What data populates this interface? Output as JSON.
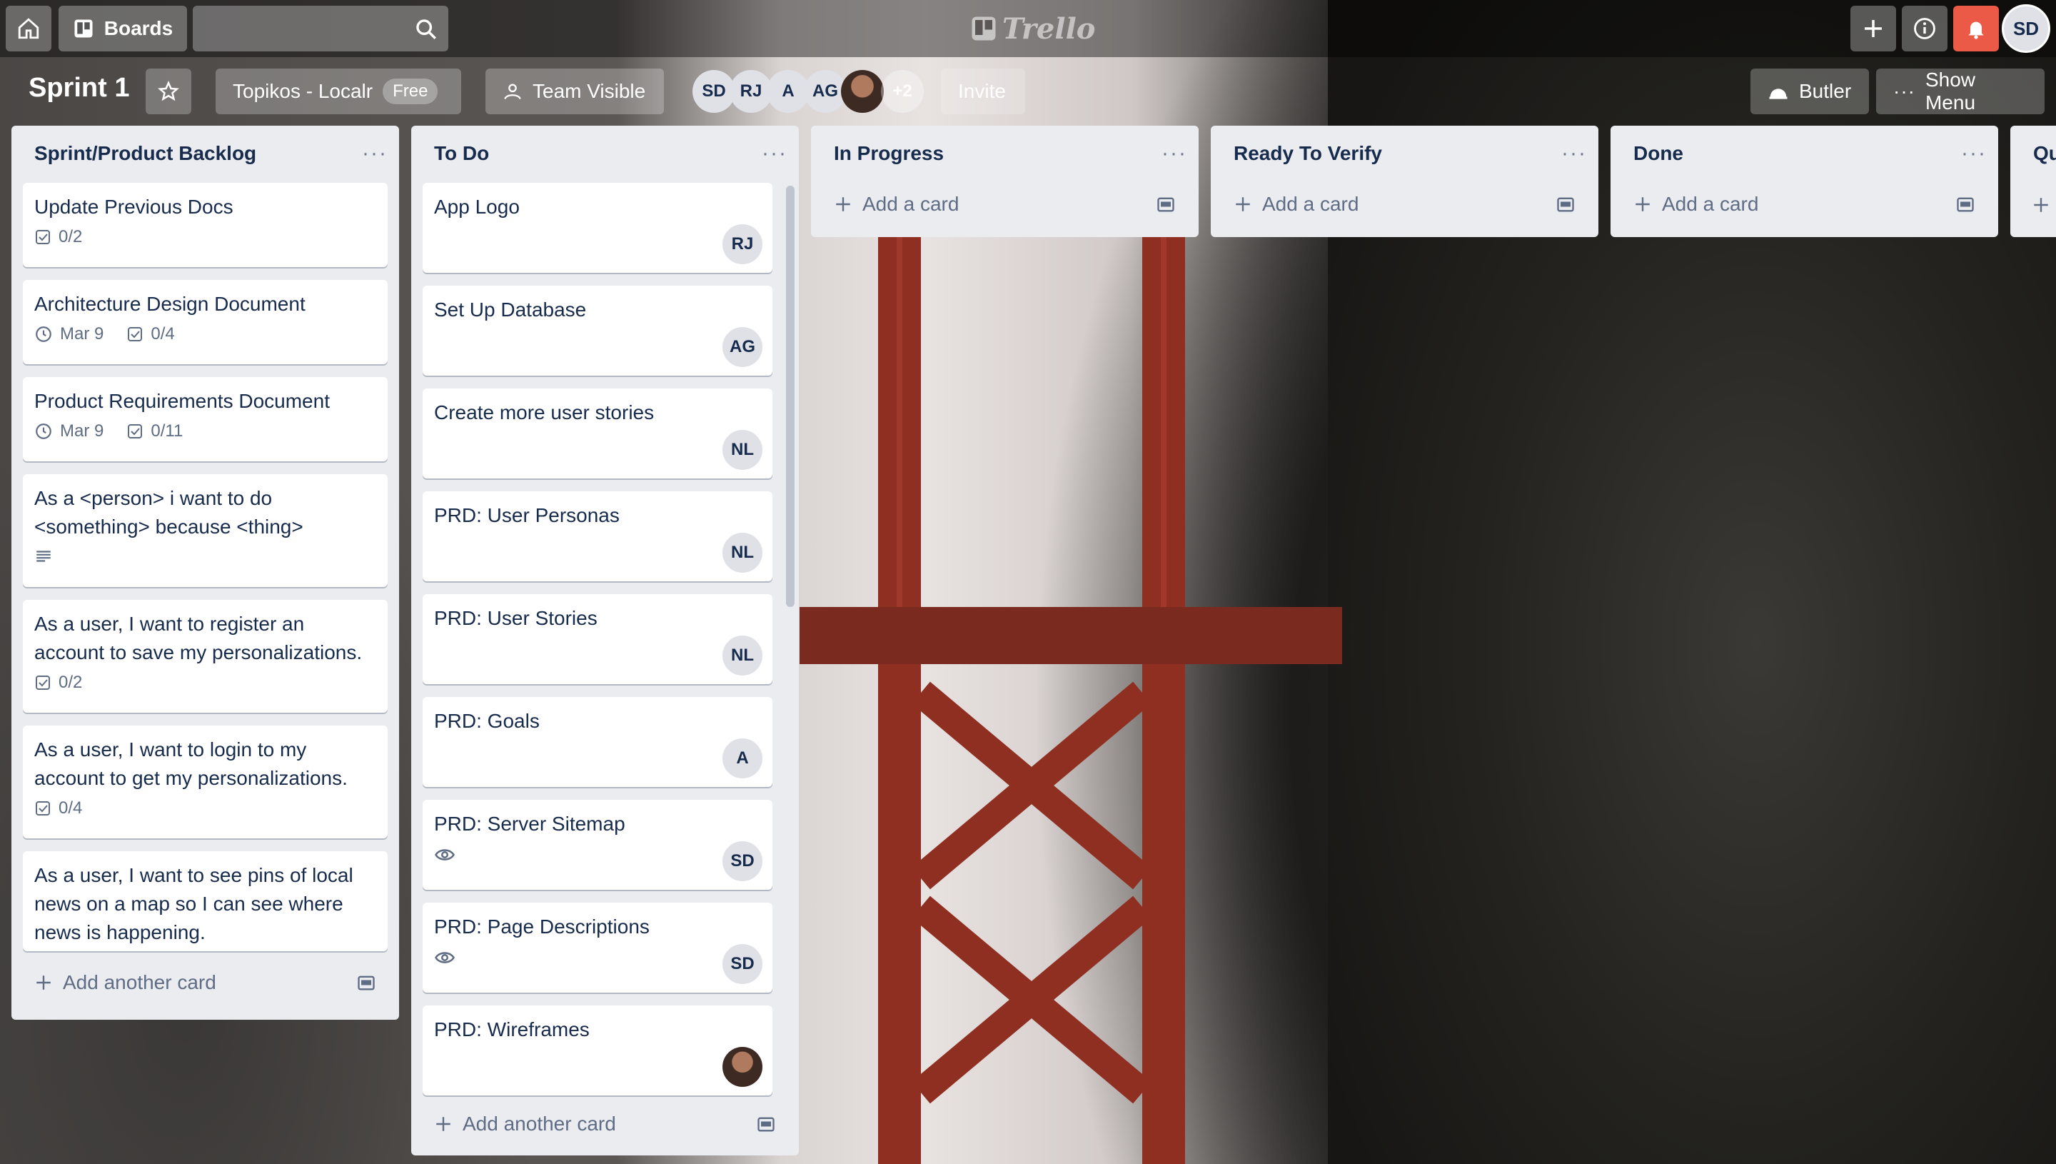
{
  "topbar": {
    "boards_label": "Boards",
    "logo_text": "Trello",
    "user_initials": "SD",
    "notification_color": "#eb5a46"
  },
  "board": {
    "title": "Sprint 1",
    "team_name": "Topikos - Localr",
    "team_plan": "Free",
    "visibility": "Team Visible",
    "members": [
      "SD",
      "RJ",
      "A",
      "AG"
    ],
    "members_more": "+2",
    "invite_label": "Invite",
    "butler_label": "Butler",
    "show_menu_label": "Show Menu"
  },
  "lists": [
    {
      "title": "Sprint/Product Backlog",
      "add_label": "Add another card",
      "cards": [
        {
          "title": "Update Previous Docs",
          "checklist": "0/2"
        },
        {
          "title": "Architecture Design Document",
          "due": "Mar 9",
          "checklist": "0/4"
        },
        {
          "title": "Product Requirements Document",
          "due": "Mar 9",
          "checklist": "0/11"
        },
        {
          "title": "As a <person> i want to do <something> because <thing>",
          "has_description": true
        },
        {
          "title": "As a user, I want to register an account to save my personalizations.",
          "checklist": "0/2"
        },
        {
          "title": "As a user, I want to login to my account to get my personalizations.",
          "checklist": "0/4"
        },
        {
          "title": "As a user, I want to see pins of local news on a map so I can see where news is happening."
        }
      ]
    },
    {
      "title": "To Do",
      "add_label": "Add another card",
      "cards": [
        {
          "title": "App Logo",
          "member": "RJ"
        },
        {
          "title": "Set Up Database",
          "member": "AG"
        },
        {
          "title": "Create more user stories",
          "member": "NL"
        },
        {
          "title": "PRD: User Personas",
          "member": "NL"
        },
        {
          "title": "PRD: User Stories",
          "member": "NL"
        },
        {
          "title": "PRD: Goals",
          "member": "A"
        },
        {
          "title": "PRD: Server Sitemap",
          "member": "SD",
          "watching": true
        },
        {
          "title": "PRD: Page Descriptions",
          "member": "SD",
          "watching": true
        },
        {
          "title": "PRD: Wireframes",
          "member_photo": true
        }
      ]
    },
    {
      "title": "In Progress",
      "add_label": "Add a card"
    },
    {
      "title": "Ready To Verify",
      "add_label": "Add a card"
    },
    {
      "title": "Done",
      "add_label": "Add a card"
    },
    {
      "title": "Qu"
    }
  ]
}
